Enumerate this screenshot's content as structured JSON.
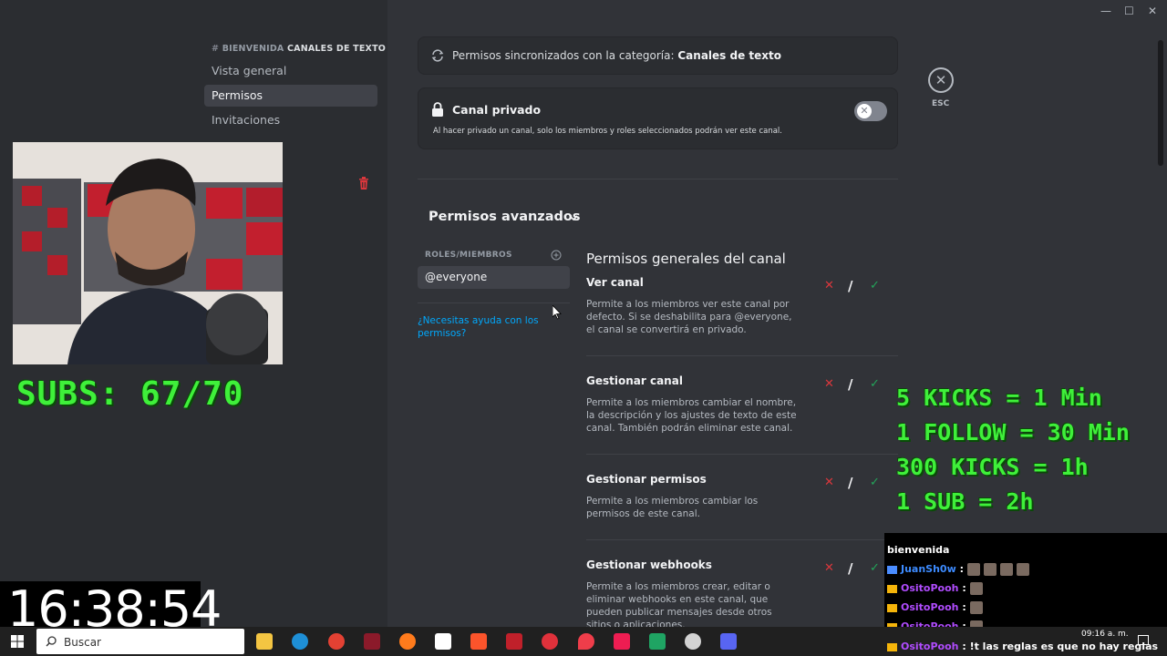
{
  "sidebar": {
    "category_hash": "#",
    "category_channel": "BIENVENIDA",
    "category_section": "CANALES DE TEXTO",
    "items": [
      {
        "label": "Vista general"
      },
      {
        "label": "Permisos"
      },
      {
        "label": "Invitaciones"
      }
    ]
  },
  "main": {
    "sync_text": "Permisos sincronizados con la categoría:",
    "sync_category": "Canales de texto",
    "private_title": "Canal privado",
    "private_desc": "Al hacer privado un canal, solo los miembros y roles seleccionados podrán ver este canal.",
    "private_toggle_on": false,
    "advanced_title": "Permisos avanzados",
    "roles_label": "ROLES/MIEMBROS",
    "role_selected": "@everyone",
    "help_link": "¿Necesitas ayuda con los permisos?",
    "section_title": "Permisos generales del canal",
    "permissions": [
      {
        "name": "Ver canal",
        "desc": "Permite a los miembros ver este canal por defecto. Si se deshabilita para @everyone, el canal se convertirá en privado."
      },
      {
        "name": "Gestionar canal",
        "desc": "Permite a los miembros cambiar el nombre, la descripción y los ajustes de texto de este canal. También podrán eliminar este canal."
      },
      {
        "name": "Gestionar permisos",
        "desc": "Permite a los miembros cambiar los permisos de este canal."
      },
      {
        "name": "Gestionar webhooks",
        "desc": "Permite a los miembros crear, editar o eliminar webhooks en este canal, que pueden publicar mensajes desde otros sitios o aplicaciones."
      }
    ],
    "perm_symbols": {
      "deny": "✕",
      "neutral": "/",
      "allow": "✓"
    },
    "close_label": "ESC"
  },
  "overlay": {
    "subs": "SUBS: 67/70",
    "rules": [
      "5 KICKS = 1 Min",
      "1 FOLLOW = 30 Min",
      "300 KICKS = 1h",
      "1 SUB = 2h"
    ],
    "clock": "16:38:54",
    "chat": {
      "line0": "bienvenida",
      "line1_user": "JuanSh0w",
      "line2_user": "OsitoPooh",
      "line3_user": "OsitoPooh",
      "line4_user": "OsitoPooh",
      "line5_user": "OsitoPooh",
      "line5_msg": "!t las reglas es que no hay reglas"
    }
  },
  "taskbar": {
    "search_placeholder": "Buscar",
    "time": "09:16 a. m."
  },
  "colors": {
    "sidebar_bg": "#2b2d31",
    "main_bg": "#313338",
    "accent_link": "#00a8fc",
    "deny": "#da373c",
    "allow": "#23a55a",
    "overlay_green": "#3ff03a"
  }
}
